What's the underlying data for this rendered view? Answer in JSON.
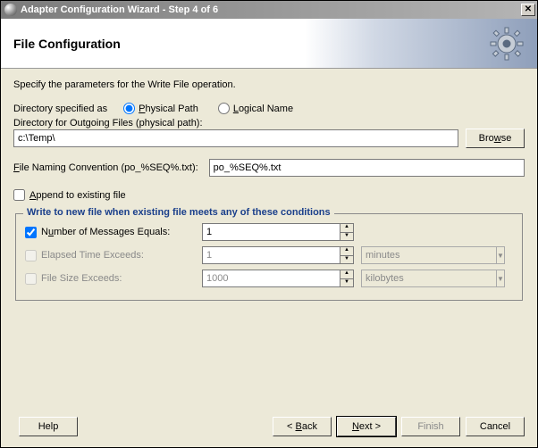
{
  "window": {
    "title": "Adapter Configuration Wizard - Step 4 of 6"
  },
  "header": {
    "title": "File Configuration"
  },
  "intro": "Specify the parameters for the Write File operation.",
  "dir_spec": {
    "label": "Directory specified as",
    "physical": "Physical Path",
    "logical": "Logical Name"
  },
  "outgoing": {
    "label": "Directory for Outgoing Files (physical path):",
    "value": "c:\\Temp\\",
    "browse": "Browse"
  },
  "naming": {
    "label": "File Naming Convention (po_%SEQ%.txt):",
    "value": "po_%SEQ%.txt"
  },
  "append": {
    "label": "Append to existing file"
  },
  "conditions": {
    "legend": "Write to new file when existing file meets any of these conditions",
    "num_msgs": {
      "label": "Number of Messages Equals:",
      "value": "1"
    },
    "elapsed": {
      "label": "Elapsed Time Exceeds:",
      "value": "1",
      "unit": "minutes"
    },
    "filesize": {
      "label": "File Size Exceeds:",
      "value": "1000",
      "unit": "kilobytes"
    }
  },
  "buttons": {
    "help": "Help",
    "back": "< Back",
    "next": "Next >",
    "finish": "Finish",
    "cancel": "Cancel"
  }
}
